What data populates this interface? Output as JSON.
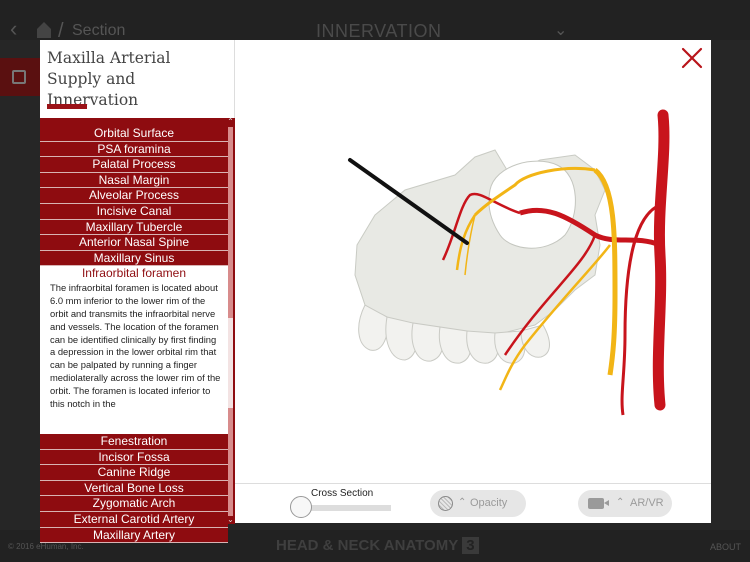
{
  "background": {
    "nav_section": "Section",
    "page_heading": "INNERVATION",
    "copyright": "© 2016 eHuman, Inc.",
    "brand": "HEAD & NECK ANATOMY",
    "brand_number": "3",
    "about": "ABOUT"
  },
  "modal": {
    "title": "Maxilla Arterial Supply and Innervation",
    "list_items_before": [
      "Orbital Surface",
      "PSA foramina",
      "Palatal Process",
      "Nasal Margin",
      "Alveolar Process",
      "Incisive Canal",
      "Maxillary Tubercle",
      "Anterior Nasal Spine",
      "Maxillary Sinus"
    ],
    "active_item": {
      "label": "Infraorbital foramen",
      "description": "The infraorbital foramen is located about 6.0 mm inferior to the lower rim of the orbit and transmits the infraorbital nerve and vessels. The location of the foramen can be identified clinically by first finding a depression in the lower orbital rim that can be palpated by running a finger mediolaterally across the lower rim of the orbit. The foramen is located inferior to this notch in the"
    },
    "list_items_after": [
      "Fenestration",
      "Incisor Fossa",
      "Canine Ridge",
      "Vertical Bone Loss",
      "Zygomatic Arch",
      "External Carotid Artery",
      "Maxillary Artery"
    ],
    "controls": {
      "cross_section_label": "Cross Section",
      "cross_section_value": 0,
      "opacity_label": "Opacity",
      "arvr_label": "AR/VR"
    }
  },
  "colors": {
    "accent": "#8e0c10",
    "artery": "#c8141c",
    "nerve": "#f2b516",
    "bone": "#e8e9e4"
  },
  "icons": [
    "back-chevron-icon",
    "home-icon",
    "chevron-down-icon",
    "close-icon",
    "opacity-icon",
    "caret-up-icon",
    "camera-icon"
  ]
}
